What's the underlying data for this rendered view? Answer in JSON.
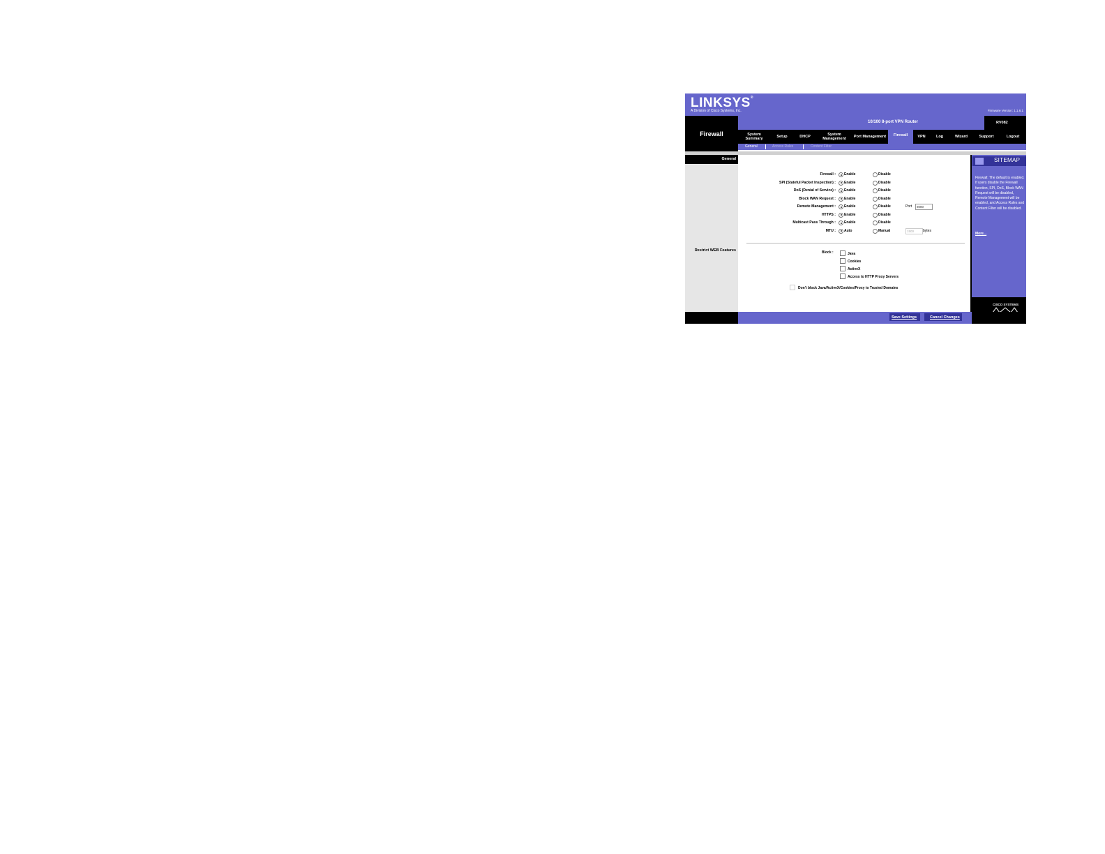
{
  "brand": {
    "logo": "LINKSYS",
    "logo_mark": "®",
    "subtitle": "A Division of Cisco Systems, Inc.",
    "firmware": "Firmware Version: 1.1.6.1"
  },
  "product": {
    "name": "10/100 8-port VPN Router",
    "model": "RV082"
  },
  "section_title": "Firewall",
  "nav": [
    {
      "label": "System Summary"
    },
    {
      "label": "Setup"
    },
    {
      "label": "DHCP"
    },
    {
      "label": "System Management"
    },
    {
      "label": "Port Management"
    },
    {
      "label": "Firewall"
    },
    {
      "label": "VPN"
    },
    {
      "label": "Log"
    },
    {
      "label": "Wizard"
    },
    {
      "label": "Support"
    },
    {
      "label": "Logout"
    }
  ],
  "subnav": [
    {
      "label": "General"
    },
    {
      "label": "Access Rules"
    },
    {
      "label": "Content Filter"
    }
  ],
  "left": {
    "tab": "General",
    "restrict_label": "Restrict WEB Features"
  },
  "settings": [
    {
      "label": "Firewall :",
      "opt1": "Enable",
      "opt2": "Disable",
      "selected": "opt1"
    },
    {
      "label": "SPI (Stateful Packet Inspection) :",
      "opt1": "Enable",
      "opt2": "Disable",
      "selected": "opt1"
    },
    {
      "label": "DoS (Denial of Service) :",
      "opt1": "Enable",
      "opt2": "Disable",
      "selected": "opt1"
    },
    {
      "label": "Block WAN Request :",
      "opt1": "Enable",
      "opt2": "Disable",
      "selected": "opt1"
    },
    {
      "label": "Remote Management :",
      "opt1": "Enable",
      "opt2": "Disable",
      "selected": "opt1",
      "extra_label": "Port",
      "extra_value": "8080"
    },
    {
      "label": "HTTPS :",
      "opt1": "Enable",
      "opt2": "Disable",
      "selected": "opt1"
    },
    {
      "label": "Multicast Pass Through :",
      "opt1": "Enable",
      "opt2": "Disable",
      "selected": "opt1"
    },
    {
      "label": "MTU :",
      "opt1": "Auto",
      "opt2": "Manual",
      "selected": "opt1",
      "extra_value": "1500",
      "extra_unit": "bytes"
    }
  ],
  "block": {
    "label": "Block :",
    "items": [
      {
        "label": "Java",
        "checked": false
      },
      {
        "label": "Cookies",
        "checked": false
      },
      {
        "label": "ActiveX",
        "checked": false
      },
      {
        "label": "Access to HTTP Proxy Servers",
        "checked": false
      }
    ],
    "trusted": "Don't block Java/ActiveX/Cookies/Proxy to Trusted Domains"
  },
  "sitemap": {
    "title": "SITEMAP",
    "help": "Firewall: The default is enabled. If users disable the Firewall function, SPI, DoS, Block WAN Request will be disabled, Remote Management will be enabled, and Access Rules and Content Filter will be disabled.",
    "more": "More..."
  },
  "cisco": "CISCO SYSTEMS",
  "footer": {
    "save": "Save Settings",
    "cancel": "Cancel Changes"
  },
  "colors": {
    "purple": "#6666cc",
    "dark_purple": "#333399",
    "black": "#000000"
  }
}
